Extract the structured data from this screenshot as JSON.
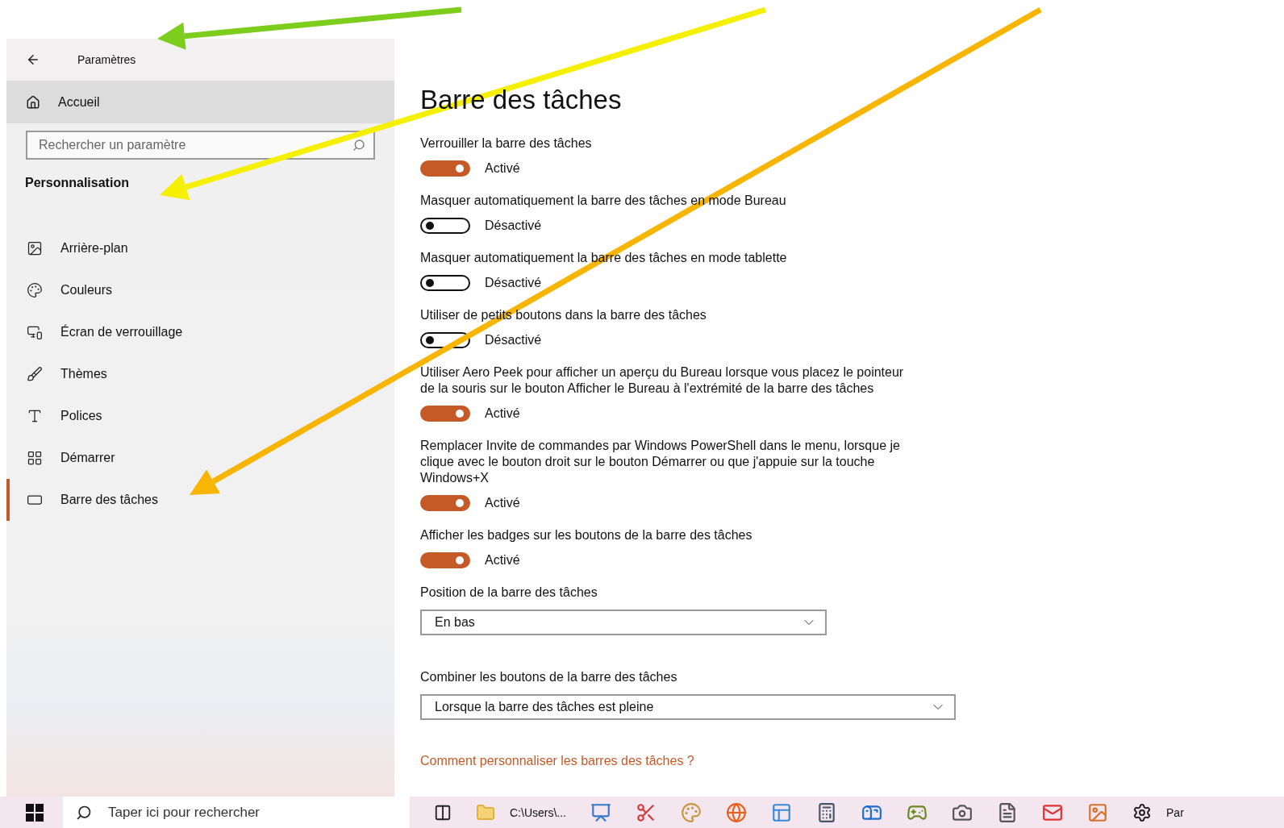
{
  "window": {
    "title": "Paramètres"
  },
  "sidebar": {
    "home": "Accueil",
    "search": {
      "placeholder": "Rechercher un paramètre"
    },
    "section": "Personnalisation",
    "items": [
      {
        "label": "Arrière-plan",
        "selected": false
      },
      {
        "label": "Couleurs",
        "selected": false
      },
      {
        "label": "Écran de verrouillage",
        "selected": false
      },
      {
        "label": "Thèmes",
        "selected": false
      },
      {
        "label": "Polices",
        "selected": false
      },
      {
        "label": "Démarrer",
        "selected": false
      },
      {
        "label": "Barre des tâches",
        "selected": true
      }
    ]
  },
  "main": {
    "title": "Barre des tâches",
    "settings": [
      {
        "kind": "toggle",
        "label": "Verrouiller la barre des tâches",
        "on": true,
        "state": "Activé"
      },
      {
        "kind": "toggle",
        "label": "Masquer automatiquement la barre des tâches en mode Bureau",
        "on": false,
        "state": "Désactivé"
      },
      {
        "kind": "toggle",
        "label": "Masquer automatiquement la barre des tâches en mode tablette",
        "on": false,
        "state": "Désactivé"
      },
      {
        "kind": "toggle",
        "label": "Utiliser de petits boutons dans la barre des tâches",
        "on": false,
        "state": "Désactivé"
      },
      {
        "kind": "toggle",
        "label": "Utiliser Aero Peek pour afficher un aperçu du Bureau lorsque vous placez le pointeur de la souris sur le bouton Afficher le Bureau à l'extrémité de la barre des tâches",
        "on": true,
        "state": "Activé"
      },
      {
        "kind": "toggle",
        "label": "Remplacer Invite de commandes par Windows PowerShell dans le menu, lorsque je clique avec le bouton droit sur le bouton Démarrer ou que j'appuie sur la touche Windows+X",
        "on": true,
        "state": "Activé"
      },
      {
        "kind": "toggle",
        "label": "Afficher les badges sur les boutons de la barre des tâches",
        "on": true,
        "state": "Activé"
      },
      {
        "kind": "dropdown",
        "label": "Position de la barre des tâches",
        "value": "En bas"
      },
      {
        "kind": "dropdown",
        "label": "Combiner les boutons de la barre des tâches",
        "value": "Lorsque la barre des tâches est pleine"
      }
    ],
    "link": "Comment personnaliser les barres des tâches ?"
  },
  "taskbar": {
    "search": {
      "placeholder": "Taper ici pour rechercher"
    },
    "folder_label": "C:\\Users\\...",
    "settings_label": "Par"
  }
}
